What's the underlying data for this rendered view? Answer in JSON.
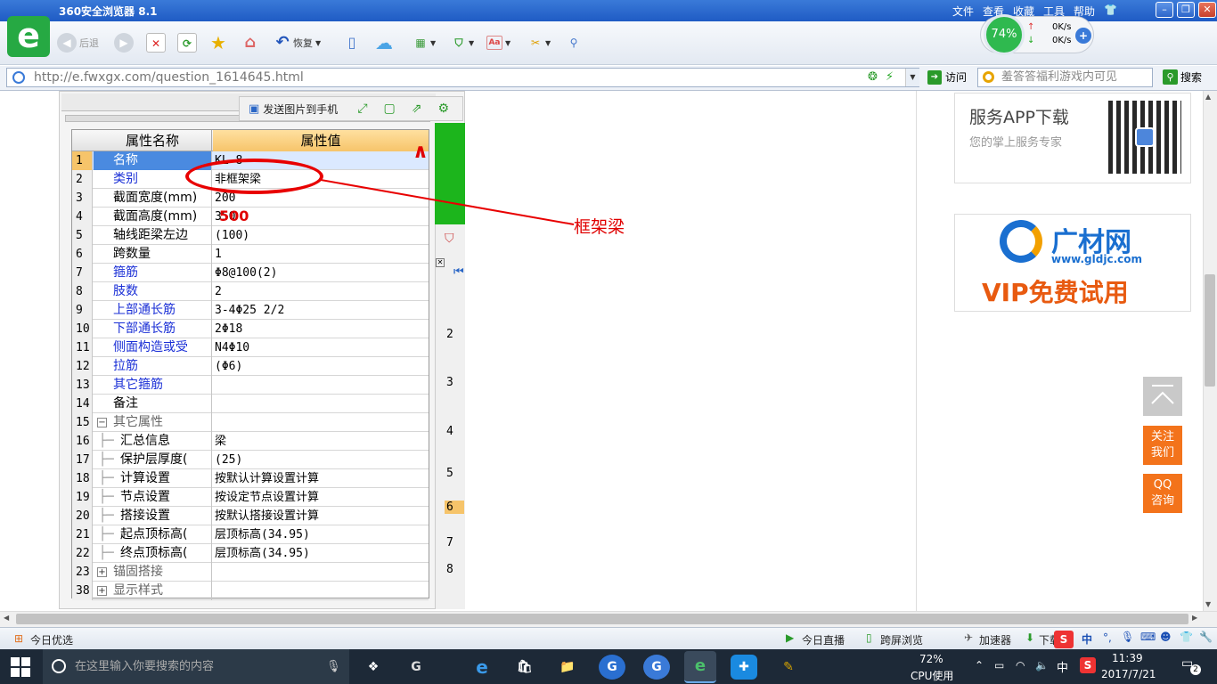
{
  "browser": {
    "title": "360安全浏览器 8.1",
    "menu": [
      "文件",
      "查看",
      "收藏",
      "工具",
      "帮助"
    ],
    "nav": {
      "back": "后退",
      "restore": "恢复"
    },
    "speed": {
      "percent": "74%",
      "up": "0K/s",
      "down": "0K/s"
    },
    "address": "http://e.fwxgx.com/question_1614645.html",
    "go_label": "访问",
    "search_placeholder": "羞答答福利游戏内可见",
    "search_button": "搜索"
  },
  "image_tools": {
    "send_label": "发送图片到手机"
  },
  "property_grid": {
    "col_name": "属性名称",
    "col_value": "属性值",
    "rows": [
      {
        "n": "1",
        "name": "名称",
        "value": "KL-8",
        "style": "blue"
      },
      {
        "n": "2",
        "name": "类别",
        "value": "非框架梁",
        "style": "blue"
      },
      {
        "n": "3",
        "name": "截面宽度(mm)",
        "value": "200",
        "style": ""
      },
      {
        "n": "4",
        "name": "截面高度(mm)",
        "value": "350",
        "style": ""
      },
      {
        "n": "5",
        "name": "轴线距梁左边",
        "value": "(100)",
        "style": ""
      },
      {
        "n": "6",
        "name": "跨数量",
        "value": "1",
        "style": ""
      },
      {
        "n": "7",
        "name": "箍筋",
        "value": "Φ8@100(2)",
        "style": "blue"
      },
      {
        "n": "8",
        "name": "肢数",
        "value": "2",
        "style": "blue"
      },
      {
        "n": "9",
        "name": "上部通长筋",
        "value": "3-4Φ25 2/2",
        "style": "blue"
      },
      {
        "n": "10",
        "name": "下部通长筋",
        "value": "2Φ18",
        "style": "blue"
      },
      {
        "n": "11",
        "name": "侧面构造或受",
        "value": "N4Φ10",
        "style": "blue"
      },
      {
        "n": "12",
        "name": "拉筋",
        "value": "(Φ6)",
        "style": "blue"
      },
      {
        "n": "13",
        "name": "其它箍筋",
        "value": "",
        "style": "blue"
      },
      {
        "n": "14",
        "name": "备注",
        "value": "",
        "style": ""
      },
      {
        "n": "15",
        "name": "其它属性",
        "value": "",
        "style": "gray",
        "toggle": "−"
      },
      {
        "n": "16",
        "name": "汇总信息",
        "value": "梁",
        "style": "",
        "indent": true
      },
      {
        "n": "17",
        "name": "保护层厚度(",
        "value": "(25)",
        "style": "",
        "indent": true
      },
      {
        "n": "18",
        "name": "计算设置",
        "value": "按默认计算设置计算",
        "style": "",
        "indent": true
      },
      {
        "n": "19",
        "name": "节点设置",
        "value": "按设定节点设置计算",
        "style": "",
        "indent": true
      },
      {
        "n": "20",
        "name": "搭接设置",
        "value": "按默认搭接设置计算",
        "style": "",
        "indent": true
      },
      {
        "n": "21",
        "name": "起点顶标高(",
        "value": "层顶标高(34.95)",
        "style": "",
        "indent": true
      },
      {
        "n": "22",
        "name": "终点顶标高(",
        "value": "层顶标高(34.95)",
        "style": "",
        "indent": true
      },
      {
        "n": "23",
        "name": "锚固搭接",
        "value": "",
        "style": "gray",
        "toggle": "+"
      },
      {
        "n": "38",
        "name": "显示样式",
        "value": "",
        "style": "gray",
        "toggle": "+"
      }
    ]
  },
  "side_grid_numbers": [
    "2",
    "3",
    "4",
    "5",
    "6",
    "7",
    "8"
  ],
  "annotations": {
    "label": "框架梁",
    "height_value": "500"
  },
  "ads": {
    "app_title": "服务APP下载",
    "app_sub": "您的掌上服务专家",
    "gld_name": "广材网",
    "gld_url": "www.gldjc.com",
    "gld_vip": "VIP免费试用"
  },
  "side_buttons": {
    "follow": "关注我们",
    "qq": "QQ咨询"
  },
  "statusbar": {
    "left": "今日优选",
    "live": "今日直播",
    "cross": "跨屏浏览",
    "accelerator": "加速器",
    "download": "下载"
  },
  "taskbar": {
    "search_placeholder": "在这里输入你要搜索的内容",
    "cpu_pct": "72%",
    "cpu_label": "CPU使用",
    "ime": "中",
    "time": "11:39",
    "date": "2017/7/21",
    "notifications": "2"
  }
}
